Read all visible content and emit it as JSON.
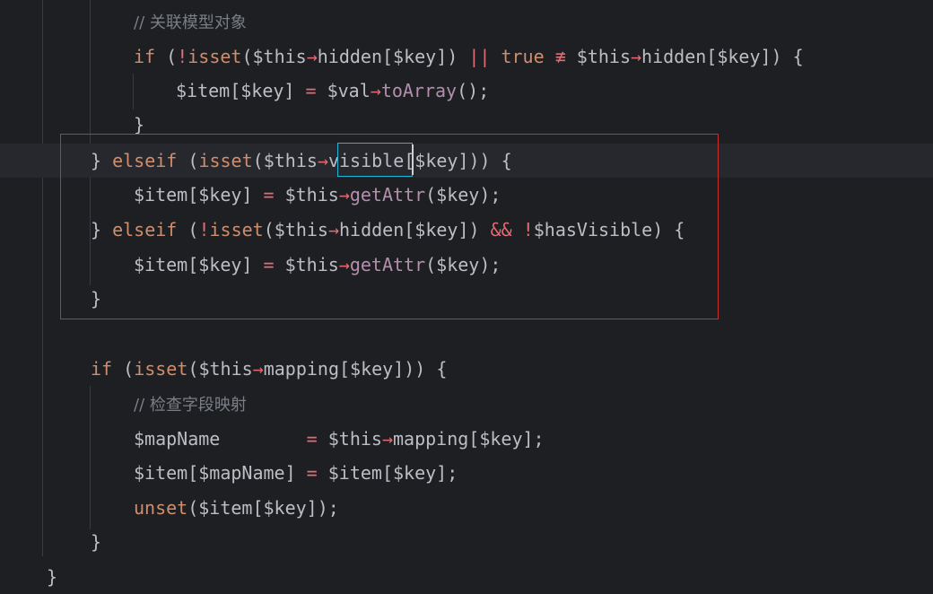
{
  "colors": {
    "background": "#1e1f22",
    "current_line": "#26282e",
    "keyword": "#cf8e6d",
    "operator": "#e06c75",
    "function": "#b48ead",
    "comment": "#7a7e85",
    "text": "#bcbec4",
    "selection_box": "#c9302c",
    "word_highlight": "#1fb6d6"
  },
  "code_lines": [
    [
      {
        "t": "// ",
        "c": "comment"
      },
      {
        "t": "关联模型对象",
        "c": "comment"
      }
    ],
    [
      {
        "t": "if",
        "c": "kw"
      },
      {
        "t": " (",
        "c": "plain"
      },
      {
        "t": "!",
        "c": "op"
      },
      {
        "t": "isset",
        "c": "kw"
      },
      {
        "t": "($this",
        "c": "plain"
      },
      {
        "t": "→",
        "c": "op"
      },
      {
        "t": "hidden[$key]) ",
        "c": "plain"
      },
      {
        "t": "||",
        "c": "op"
      },
      {
        "t": " ",
        "c": "plain"
      },
      {
        "t": "true",
        "c": "kw"
      },
      {
        "t": " ",
        "c": "plain"
      },
      {
        "t": "≢",
        "c": "op"
      },
      {
        "t": " $this",
        "c": "plain"
      },
      {
        "t": "→",
        "c": "op"
      },
      {
        "t": "hidden[$key]) {",
        "c": "plain"
      }
    ],
    [
      {
        "t": "$item[$key] ",
        "c": "plain"
      },
      {
        "t": "=",
        "c": "op"
      },
      {
        "t": " $val",
        "c": "plain"
      },
      {
        "t": "→",
        "c": "op"
      },
      {
        "t": "toArray",
        "c": "fn"
      },
      {
        "t": "();",
        "c": "plain"
      }
    ],
    [
      {
        "t": "}",
        "c": "plain"
      }
    ],
    [
      {
        "t": "} ",
        "c": "plain"
      },
      {
        "t": "elseif",
        "c": "kw"
      },
      {
        "t": " (",
        "c": "plain"
      },
      {
        "t": "isset",
        "c": "kw"
      },
      {
        "t": "($this",
        "c": "plain"
      },
      {
        "t": "→",
        "c": "op"
      },
      {
        "t": "visible",
        "c": "plain"
      },
      {
        "t": "[$key])) {",
        "c": "plain"
      }
    ],
    [
      {
        "t": "$item[$key] ",
        "c": "plain"
      },
      {
        "t": "=",
        "c": "op"
      },
      {
        "t": " $this",
        "c": "plain"
      },
      {
        "t": "→",
        "c": "op"
      },
      {
        "t": "getAttr",
        "c": "fn"
      },
      {
        "t": "($key);",
        "c": "plain"
      }
    ],
    [
      {
        "t": "} ",
        "c": "plain"
      },
      {
        "t": "elseif",
        "c": "kw"
      },
      {
        "t": " (",
        "c": "plain"
      },
      {
        "t": "!",
        "c": "op"
      },
      {
        "t": "isset",
        "c": "kw"
      },
      {
        "t": "($this",
        "c": "plain"
      },
      {
        "t": "→",
        "c": "op"
      },
      {
        "t": "hidden[$key]) ",
        "c": "plain"
      },
      {
        "t": "&&",
        "c": "op"
      },
      {
        "t": " ",
        "c": "plain"
      },
      {
        "t": "!",
        "c": "op"
      },
      {
        "t": "$hasVisible) {",
        "c": "plain"
      }
    ],
    [
      {
        "t": "$item[$key] ",
        "c": "plain"
      },
      {
        "t": "=",
        "c": "op"
      },
      {
        "t": " $this",
        "c": "plain"
      },
      {
        "t": "→",
        "c": "op"
      },
      {
        "t": "getAttr",
        "c": "fn"
      },
      {
        "t": "($key);",
        "c": "plain"
      }
    ],
    [
      {
        "t": "}",
        "c": "plain"
      }
    ],
    [],
    [
      {
        "t": "if",
        "c": "kw"
      },
      {
        "t": " (",
        "c": "plain"
      },
      {
        "t": "isset",
        "c": "kw"
      },
      {
        "t": "($this",
        "c": "plain"
      },
      {
        "t": "→",
        "c": "op"
      },
      {
        "t": "mapping[$key])) {",
        "c": "plain"
      }
    ],
    [
      {
        "t": "// ",
        "c": "comment"
      },
      {
        "t": "检查字段映射",
        "c": "comment"
      }
    ],
    [
      {
        "t": "$mapName        ",
        "c": "plain"
      },
      {
        "t": "=",
        "c": "op"
      },
      {
        "t": " $this",
        "c": "plain"
      },
      {
        "t": "→",
        "c": "op"
      },
      {
        "t": "mapping[$key];",
        "c": "plain"
      }
    ],
    [
      {
        "t": "$item[$mapName] ",
        "c": "plain"
      },
      {
        "t": "=",
        "c": "op"
      },
      {
        "t": " $item[$key];",
        "c": "plain"
      }
    ],
    [
      {
        "t": "unset",
        "c": "kw"
      },
      {
        "t": "($item[$key]);",
        "c": "plain"
      }
    ],
    [
      {
        "t": "}",
        "c": "plain"
      }
    ],
    [
      {
        "t": "}",
        "c": "plain"
      }
    ]
  ]
}
